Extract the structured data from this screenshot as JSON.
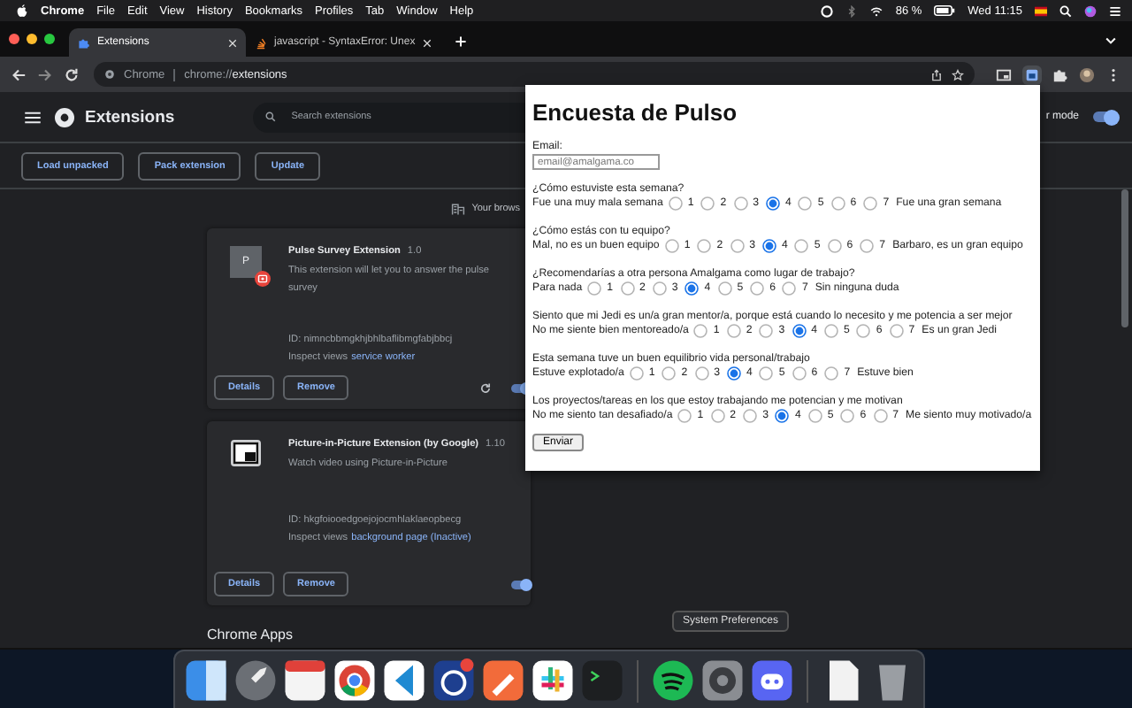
{
  "menu_bar": {
    "app": "Chrome",
    "items": [
      "File",
      "Edit",
      "View",
      "History",
      "Bookmarks",
      "Profiles",
      "Tab",
      "Window",
      "Help"
    ],
    "battery": "86 %",
    "clock": "Wed 11:15"
  },
  "tabs": [
    {
      "label": "Extensions",
      "selected": true,
      "kind": "puzzle"
    },
    {
      "label": "javascript - SyntaxError: Unex",
      "selected": false,
      "kind": "stack"
    }
  ],
  "address": {
    "origin": "Chrome",
    "url": "chrome://**extensions**"
  },
  "extensions_page": {
    "title": "Extensions",
    "search_placeholder": "Search extensions",
    "dev_mode_label": "r mode",
    "dev_mode_on": true,
    "buttons": [
      "Load unpacked",
      "Pack extension",
      "Update"
    ],
    "notice": "Your brows",
    "cards": [
      {
        "kind": "unpacked",
        "icon_letter": "P",
        "name": "Pulse Survey Extension",
        "version": "1.0",
        "description": "This extension will let you to answer the pulse survey",
        "id": "ID: nimncbbmgkhjbhlbaflibmgfabjbbcj",
        "inspect_label": "Inspect views",
        "inspect_link": "service worker",
        "buttons": [
          "Details",
          "Remove"
        ],
        "enabled": true
      },
      {
        "kind": "store",
        "name": "Picture-in-Picture Extension (by Google)",
        "version": "1.10",
        "description": "Watch video using Picture-in-Picture",
        "id": "ID: hkgfoiooedgoejojocmhlaklaeopbecg",
        "inspect_label": "Inspect views",
        "inspect_link": "background page (Inactive)",
        "buttons": [
          "Details",
          "Remove"
        ],
        "enabled": true
      }
    ],
    "section": "Chrome Apps"
  },
  "popup": {
    "title": "Encuesta de Pulso",
    "email_label": "Email:",
    "email_placeholder": "email@amalgama.co",
    "questions": [
      {
        "question": "¿Cómo estuviste esta semana?",
        "low": "Fue una muy mala semana",
        "high": "Fue una gran semana",
        "options": [
          {
            "label": "1",
            "selected": false
          },
          {
            "label": "2",
            "selected": false
          },
          {
            "label": "3",
            "selected": false
          },
          {
            "label": "4",
            "selected": true
          },
          {
            "label": "5",
            "selected": false
          },
          {
            "label": "6",
            "selected": false
          },
          {
            "label": "7",
            "selected": false
          }
        ]
      },
      {
        "question": "¿Cómo estás con tu equipo?",
        "low": "Mal, no es un buen equipo",
        "high": "Barbaro, es un gran equipo",
        "options": [
          {
            "label": "1",
            "selected": false
          },
          {
            "label": "2",
            "selected": false
          },
          {
            "label": "3",
            "selected": false
          },
          {
            "label": "4",
            "selected": true
          },
          {
            "label": "5",
            "selected": false
          },
          {
            "label": "6",
            "selected": false
          },
          {
            "label": "7",
            "selected": false
          }
        ]
      },
      {
        "question": "¿Recomendarías a otra persona Amalgama como lugar de trabajo?",
        "low": "Para nada",
        "high": "Sin ninguna duda",
        "options": [
          {
            "label": "1",
            "selected": false
          },
          {
            "label": "2",
            "selected": false
          },
          {
            "label": "3",
            "selected": false
          },
          {
            "label": "4",
            "selected": true
          },
          {
            "label": "5",
            "selected": false
          },
          {
            "label": "6",
            "selected": false
          },
          {
            "label": "7",
            "selected": false
          }
        ]
      },
      {
        "question": "Siento que mi Jedi es un/a gran mentor/a, porque está cuando lo necesito y me potencia a ser mejor",
        "low": "No me siente bien mentoreado/a",
        "high": "Es un gran Jedi",
        "options": [
          {
            "label": "1",
            "selected": false
          },
          {
            "label": "2",
            "selected": false
          },
          {
            "label": "3",
            "selected": false
          },
          {
            "label": "4",
            "selected": true
          },
          {
            "label": "5",
            "selected": false
          },
          {
            "label": "6",
            "selected": false
          },
          {
            "label": "7",
            "selected": false
          }
        ]
      },
      {
        "question": "Esta semana tuve un buen equilibrio vida personal/trabajo",
        "low": "Estuve explotado/a",
        "high": "Estuve bien",
        "options": [
          {
            "label": "1",
            "selected": false
          },
          {
            "label": "2",
            "selected": false
          },
          {
            "label": "3",
            "selected": false
          },
          {
            "label": "4",
            "selected": true
          },
          {
            "label": "5",
            "selected": false
          },
          {
            "label": "6",
            "selected": false
          },
          {
            "label": "7",
            "selected": false
          }
        ]
      },
      {
        "question": "Los proyectos/tareas en los que estoy trabajando me potencian y me motivan",
        "low": "No me siento tan desafiado/a",
        "high": "Me siento muy motivado/a",
        "options": [
          {
            "label": "1",
            "selected": false
          },
          {
            "label": "2",
            "selected": false
          },
          {
            "label": "3",
            "selected": false
          },
          {
            "label": "4",
            "selected": true
          },
          {
            "label": "5",
            "selected": false
          },
          {
            "label": "6",
            "selected": false
          },
          {
            "label": "7",
            "selected": false
          }
        ]
      }
    ],
    "submit": "Enviar"
  },
  "tooltip": "System Preferences"
}
